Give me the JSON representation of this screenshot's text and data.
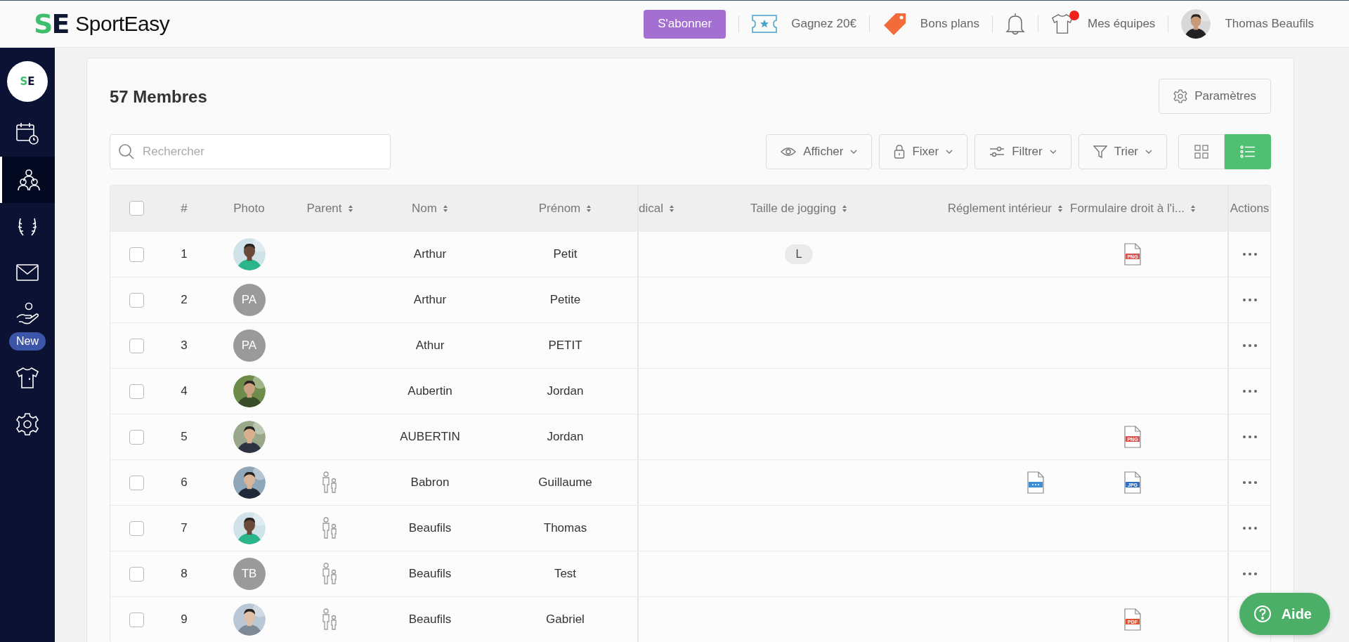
{
  "topbar": {
    "logo": {
      "mark_left": "S",
      "mark_right": "E",
      "name": "SportEasy"
    },
    "subscribe": "S'abonner",
    "links": [
      {
        "kind": "ticket",
        "label": "Gagnez 20€",
        "notification": false
      },
      {
        "kind": "tag",
        "label": "Bons plans",
        "notification": false
      },
      {
        "kind": "bell",
        "notification": false
      },
      {
        "kind": "shirt",
        "label": "Mes équipes",
        "notification": true
      }
    ],
    "user": {
      "name": "Thomas Beaufils"
    }
  },
  "sidebar": {
    "logo": {
      "mark_left": "S",
      "mark_right": "E"
    },
    "items": [
      {
        "kind": "calendar",
        "selected": false
      },
      {
        "kind": "members",
        "selected": true
      },
      {
        "kind": "laurel",
        "selected": false
      },
      {
        "kind": "mail",
        "selected": false
      },
      {
        "kind": "helping-hand",
        "selected": false,
        "badge": "New"
      },
      {
        "kind": "shirt",
        "selected": false
      },
      {
        "kind": "settings",
        "selected": false
      }
    ]
  },
  "page": {
    "title": "57 Membres",
    "settings_button": "Paramètres",
    "search": {
      "placeholder": "Rechercher"
    },
    "toolbar": [
      {
        "kind": "eye",
        "label": "Afficher"
      },
      {
        "kind": "lock",
        "label": "Fixer"
      },
      {
        "kind": "sliders",
        "label": "Filtrer"
      },
      {
        "kind": "funnel",
        "label": "Trier"
      }
    ],
    "views": [
      {
        "kind": "grid",
        "selected": false
      },
      {
        "kind": "list",
        "selected": true
      }
    ]
  },
  "table": {
    "select_all": {
      "checked": false
    },
    "columns": [
      {
        "label": "#",
        "sortable": false
      },
      {
        "label": "Photo",
        "sortable": false
      },
      {
        "label": "Parent",
        "sortable": true
      },
      {
        "label": "Nom",
        "sortable": true
      },
      {
        "label": "Prénom",
        "sortable": true
      },
      {
        "label": "dical",
        "sortable": true
      },
      {
        "label": "Taille de jogging",
        "sortable": true
      },
      {
        "label": "Réglement intérieur",
        "sortable": true
      },
      {
        "label": "Formulaire droit à l'i...",
        "sortable": true
      },
      {
        "label": "Actions",
        "sortable": false
      }
    ],
    "rows": [
      {
        "number": "1",
        "checked": false,
        "parent": false,
        "nom": "Arthur",
        "prenom": "Petit",
        "taille": "L",
        "formulaire": {
          "kind": "file",
          "type": "PNG",
          "color": "#d9534f"
        }
      },
      {
        "number": "2",
        "checked": false,
        "avatar": {
          "kind": "initials",
          "text": "PA"
        },
        "parent": false,
        "nom": "Arthur",
        "prenom": "Petite"
      },
      {
        "number": "3",
        "checked": false,
        "avatar": {
          "kind": "initials",
          "text": "PA"
        },
        "parent": false,
        "nom": "Athur",
        "prenom": "PETIT"
      },
      {
        "number": "4",
        "checked": false,
        "parent": false,
        "nom": "Aubertin",
        "prenom": "Jordan"
      },
      {
        "number": "5",
        "checked": false,
        "parent": false,
        "nom": "AUBERTIN",
        "prenom": "Jordan",
        "formulaire": {
          "kind": "file",
          "type": "PNG",
          "color": "#d9534f"
        }
      },
      {
        "number": "6",
        "checked": false,
        "parent": true,
        "nom": "Babron",
        "prenom": "Guillaume",
        "reglement": {
          "kind": "document",
          "color": "#3b8fd6"
        },
        "formulaire": {
          "kind": "file",
          "type": "JPG",
          "color": "#2f6fc2"
        }
      },
      {
        "number": "7",
        "checked": false,
        "parent": true,
        "nom": "Beaufils",
        "prenom": "Thomas"
      },
      {
        "number": "8",
        "checked": false,
        "avatar": {
          "kind": "initials",
          "text": "TB"
        },
        "parent": true,
        "nom": "Beaufils",
        "prenom": "Test"
      },
      {
        "number": "9",
        "checked": false,
        "parent": true,
        "nom": "Beaufils",
        "prenom": "Gabriel",
        "formulaire": {
          "kind": "file",
          "type": "PDF",
          "color": "#e0532f"
        }
      }
    ]
  },
  "help_button": {
    "label": "Aide"
  }
}
